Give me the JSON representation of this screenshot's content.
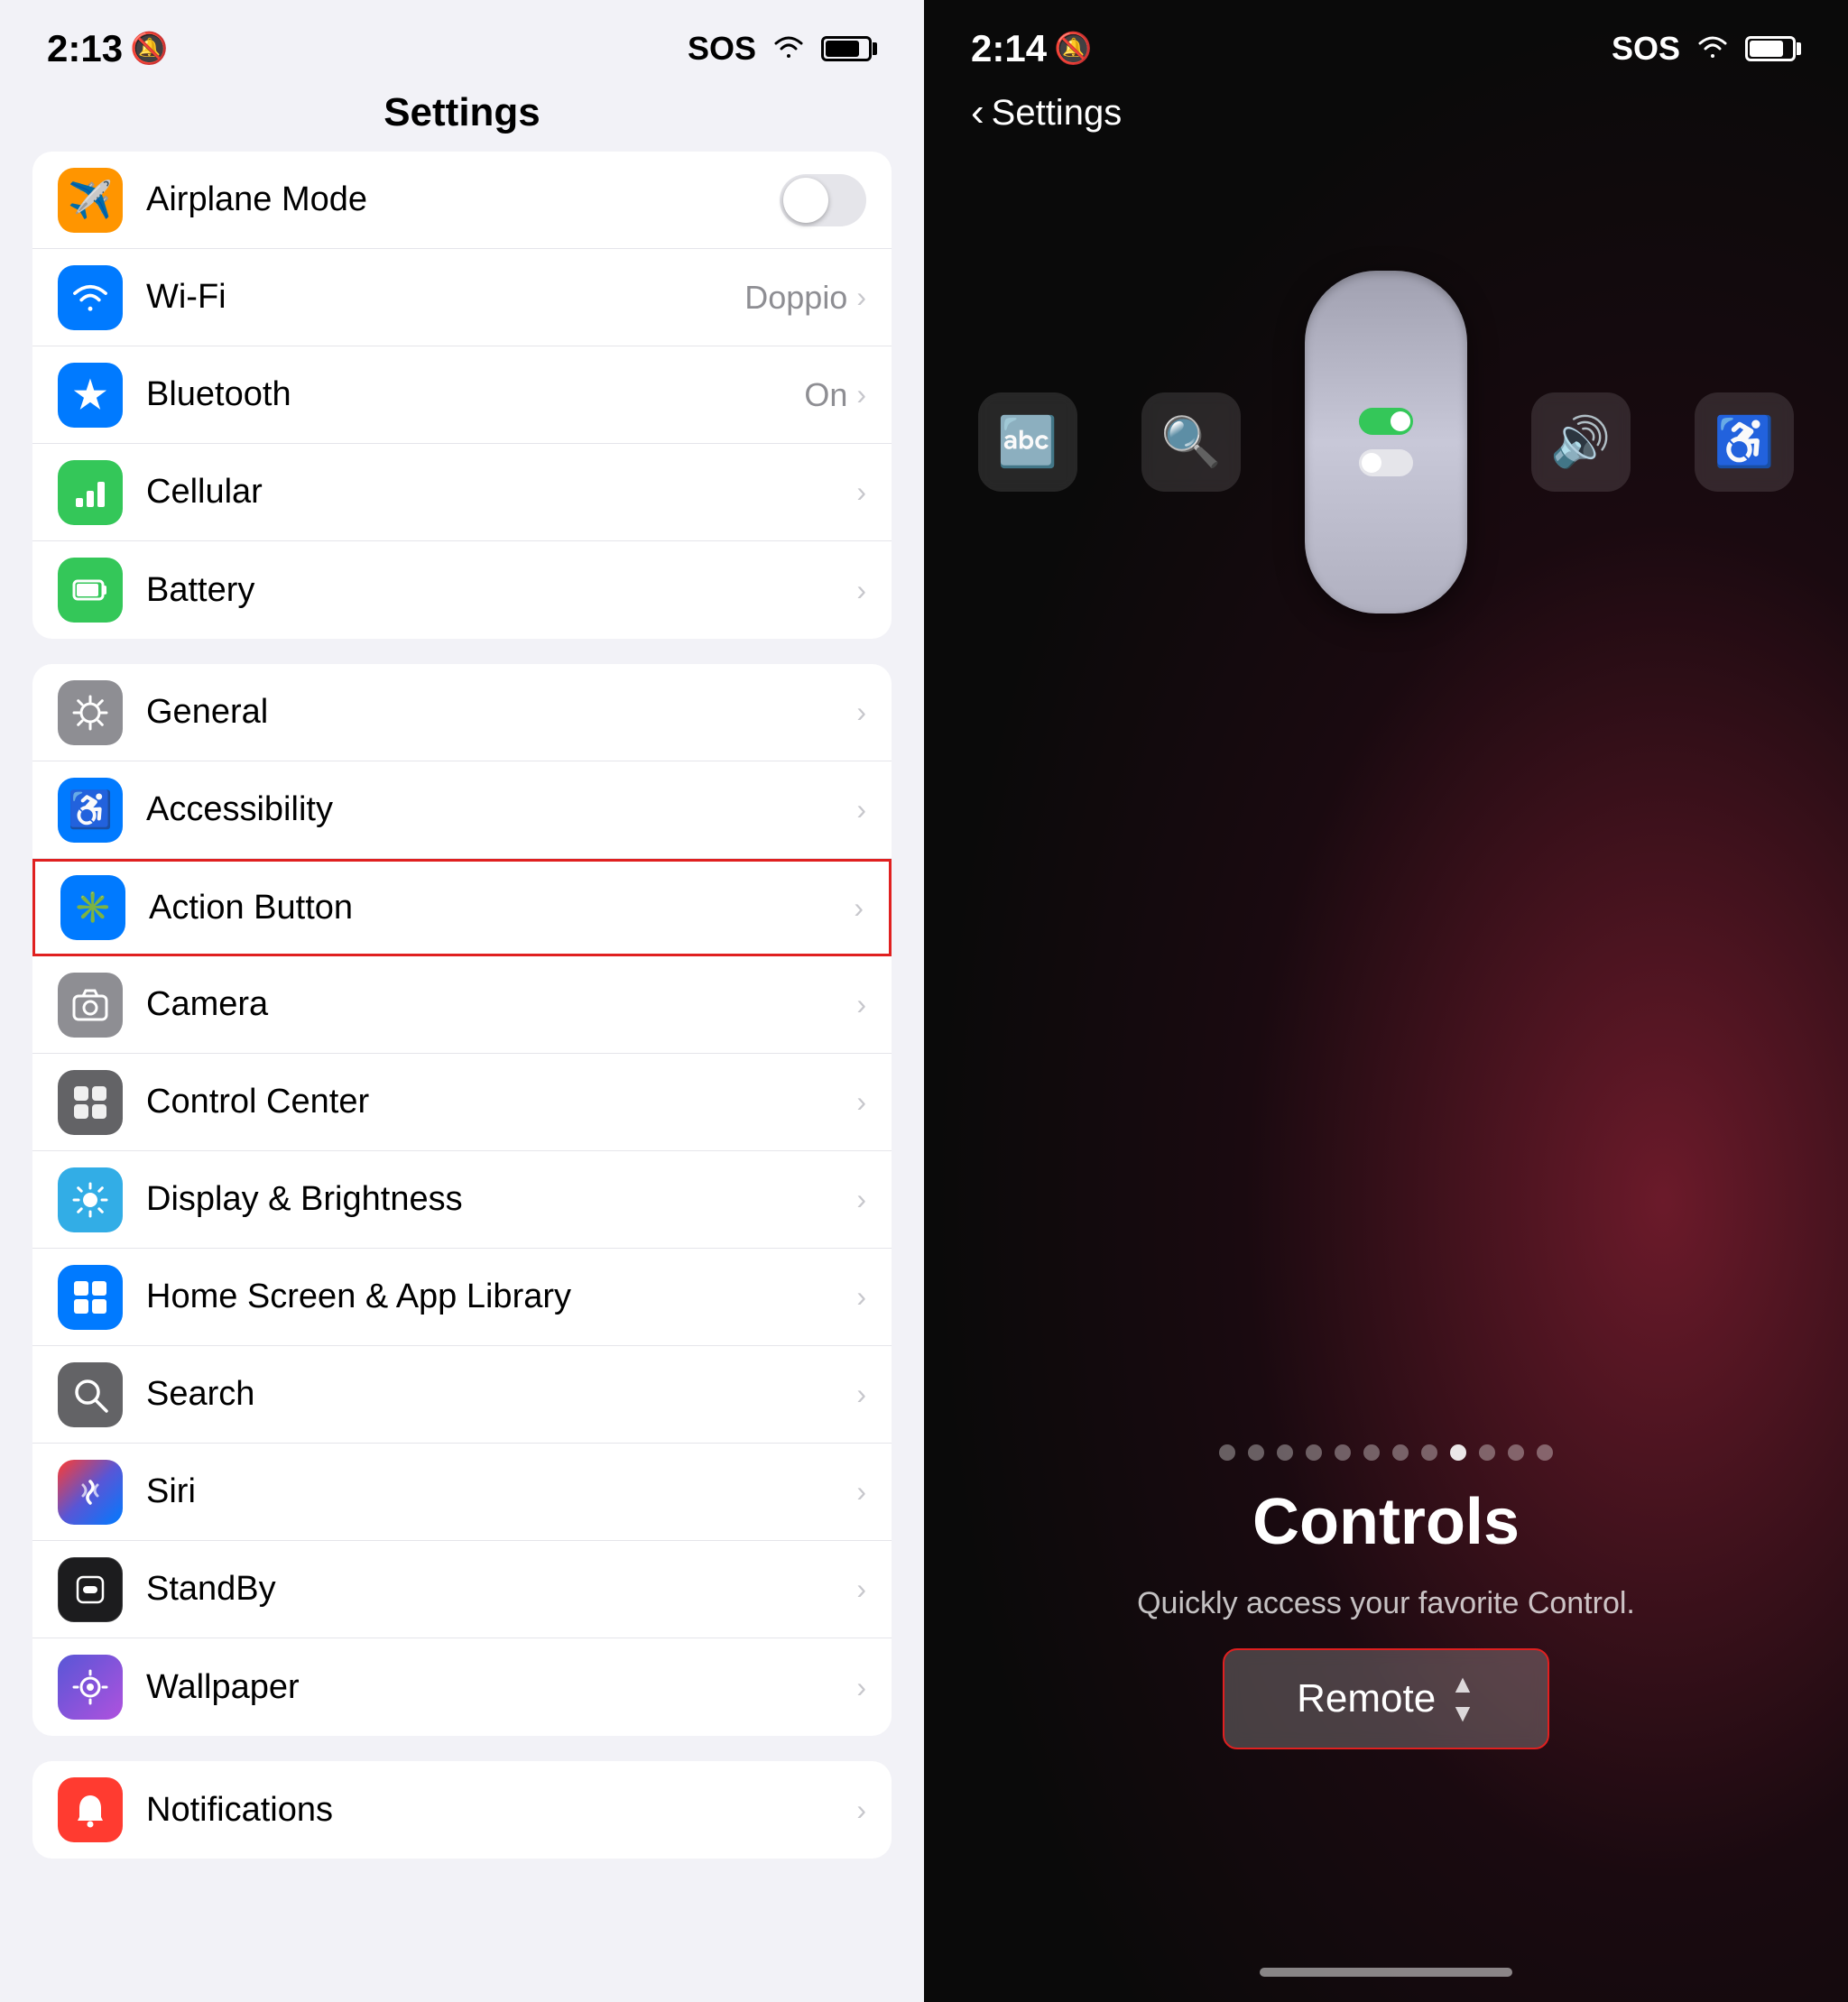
{
  "left": {
    "statusBar": {
      "time": "2:13",
      "bellIcon": "🔔",
      "sos": "SOS",
      "wifi": "wifi",
      "battery": "battery"
    },
    "title": "Settings",
    "groups": [
      {
        "id": "connectivity",
        "items": [
          {
            "id": "airplane-mode",
            "icon": "✈️",
            "iconClass": "icon-orange",
            "label": "Airplane Mode",
            "value": "",
            "hasToggle": true,
            "toggleOn": false,
            "hasChevron": false
          },
          {
            "id": "wifi",
            "icon": "📶",
            "iconClass": "icon-blue",
            "label": "Wi-Fi",
            "value": "Doppio",
            "hasToggle": false,
            "hasChevron": true
          },
          {
            "id": "bluetooth",
            "icon": "🔵",
            "iconClass": "icon-blue",
            "label": "Bluetooth",
            "value": "On",
            "hasToggle": false,
            "hasChevron": true
          },
          {
            "id": "cellular",
            "icon": "📡",
            "iconClass": "icon-green",
            "label": "Cellular",
            "value": "",
            "hasToggle": false,
            "hasChevron": true
          },
          {
            "id": "battery",
            "icon": "🔋",
            "iconClass": "icon-green",
            "label": "Battery",
            "value": "",
            "hasToggle": false,
            "hasChevron": true
          }
        ]
      },
      {
        "id": "system",
        "items": [
          {
            "id": "general",
            "icon": "⚙️",
            "iconClass": "icon-gray",
            "label": "General",
            "value": "",
            "hasToggle": false,
            "hasChevron": true,
            "highlighted": false
          },
          {
            "id": "accessibility",
            "icon": "♿",
            "iconClass": "icon-blue-acc",
            "label": "Accessibility",
            "value": "",
            "hasToggle": false,
            "hasChevron": true,
            "highlighted": false
          },
          {
            "id": "action-button",
            "icon": "✳️",
            "iconClass": "icon-blue-acc",
            "label": "Action Button",
            "value": "",
            "hasToggle": false,
            "hasChevron": true,
            "highlighted": true
          },
          {
            "id": "camera",
            "icon": "📷",
            "iconClass": "icon-camera",
            "label": "Camera",
            "value": "",
            "hasToggle": false,
            "hasChevron": true,
            "highlighted": false
          },
          {
            "id": "control-center",
            "icon": "🎛️",
            "iconClass": "icon-ctrl",
            "label": "Control Center",
            "value": "",
            "hasToggle": false,
            "hasChevron": true,
            "highlighted": false
          },
          {
            "id": "display-brightness",
            "icon": "☀️",
            "iconClass": "icon-display",
            "label": "Display & Brightness",
            "value": "",
            "hasToggle": false,
            "hasChevron": true,
            "highlighted": false
          },
          {
            "id": "home-screen",
            "icon": "📱",
            "iconClass": "icon-home",
            "label": "Home Screen & App Library",
            "value": "",
            "hasToggle": false,
            "hasChevron": true,
            "highlighted": false
          },
          {
            "id": "search",
            "icon": "🔍",
            "iconClass": "icon-search",
            "label": "Search",
            "value": "",
            "hasToggle": false,
            "hasChevron": true,
            "highlighted": false
          },
          {
            "id": "siri",
            "icon": "🎙️",
            "iconClass": "icon-siri",
            "label": "Siri",
            "value": "",
            "hasToggle": false,
            "hasChevron": true,
            "highlighted": false
          },
          {
            "id": "standby",
            "icon": "🌙",
            "iconClass": "icon-standby",
            "label": "StandBy",
            "value": "",
            "hasToggle": false,
            "hasChevron": true,
            "highlighted": false
          },
          {
            "id": "wallpaper",
            "icon": "🖼️",
            "iconClass": "icon-wallpaper",
            "label": "Wallpaper",
            "value": "",
            "hasToggle": false,
            "hasChevron": true,
            "highlighted": false
          }
        ]
      },
      {
        "id": "notifications-group",
        "items": [
          {
            "id": "notifications",
            "icon": "🔔",
            "iconClass": "icon-notif",
            "label": "Notifications",
            "value": "",
            "hasToggle": false,
            "hasChevron": true,
            "highlighted": false,
            "partial": true
          }
        ]
      }
    ]
  },
  "right": {
    "statusBar": {
      "time": "2:14",
      "bellIcon": "🔔",
      "sos": "SOS",
      "wifi": "wifi",
      "battery": "battery"
    },
    "backLabel": "Settings",
    "paginationDots": 12,
    "activeDot": 8,
    "title": "Controls",
    "subtitle": "Quickly access your favorite Control.",
    "remoteButton": "Remote",
    "homeIndicator": true
  },
  "icons": {
    "chevron": "›",
    "backChevron": "‹",
    "wifi": "≋",
    "bell": "🔕"
  }
}
